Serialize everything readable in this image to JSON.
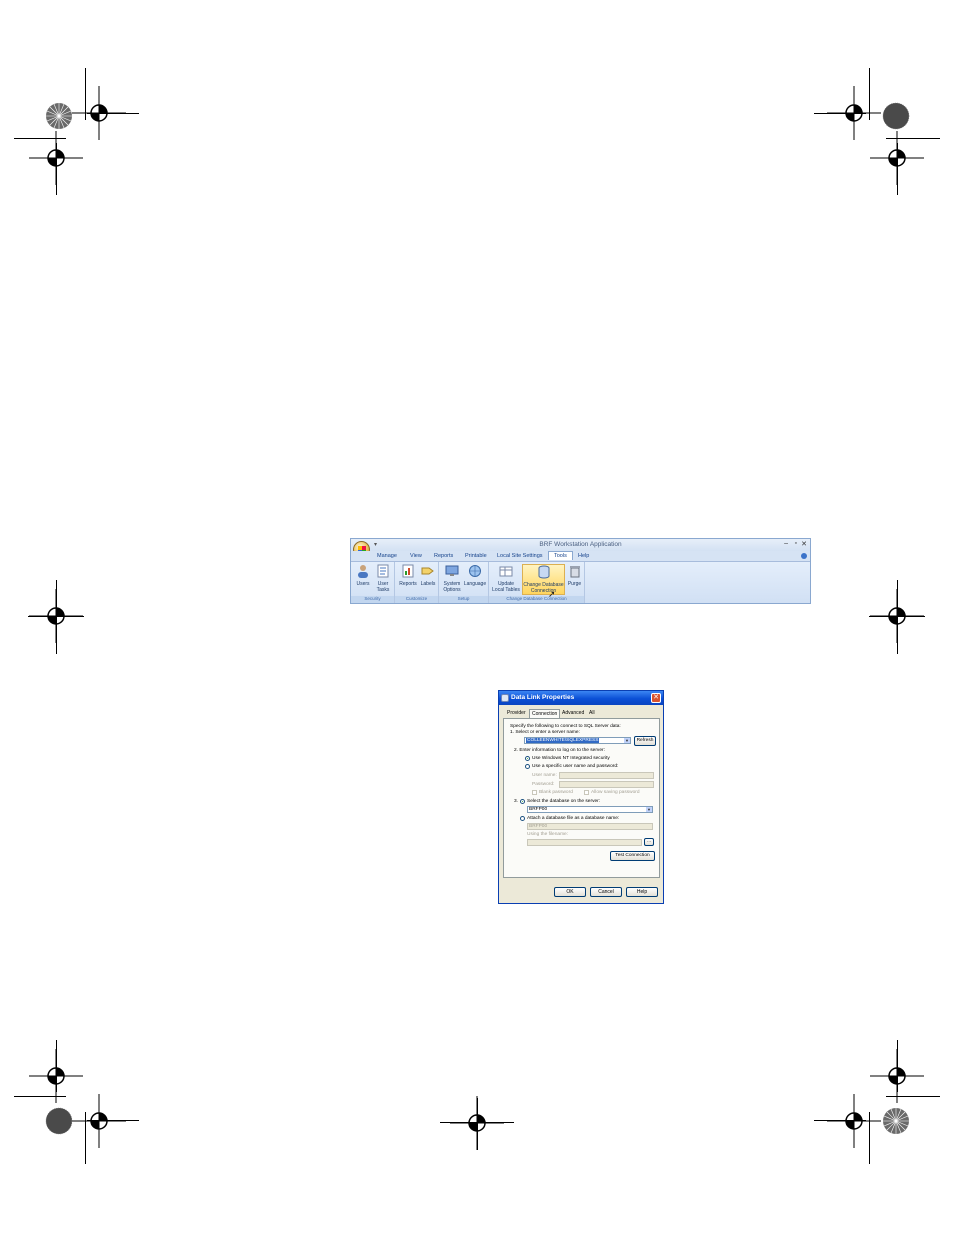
{
  "ribbon": {
    "title": "BRF Workstation Application",
    "qat": "▾",
    "controls": [
      "–",
      "▫",
      "✕"
    ],
    "tabs": [
      "Manage",
      "View",
      "Reports",
      "Printable",
      "Local Site Settings",
      "Tools",
      "Help"
    ],
    "active_tab": "Tools",
    "groups": [
      {
        "label": "Security",
        "commands": [
          "Users",
          "User\nTasks"
        ]
      },
      {
        "label": "Customize",
        "commands": [
          "Reports",
          "Labels"
        ]
      },
      {
        "label": "Setup",
        "commands": [
          "System\nOptions",
          "Language"
        ]
      },
      {
        "label": "Change Database Connection",
        "commands": [
          "Update\nLocal Tables",
          "Change Database\nConnection",
          "Purge"
        ]
      }
    ]
  },
  "dialog": {
    "title": "Data Link Properties",
    "close": "✕",
    "tabs": [
      "Provider",
      "Connection",
      "Advanced",
      "All"
    ],
    "active_tab": "Connection",
    "intro": "Specify the following to connect to SQL Server data:",
    "step1": "1. Select or enter a server name:",
    "server_value": "COLLEENWHITE\\SQLEXPRESS",
    "refresh": "Refresh",
    "step2": "2. Enter information to log on to the server:",
    "opt_nt": "Use Windows NT Integrated security",
    "opt_specific": "Use a specific user name and password:",
    "user_name": "User name:",
    "password": "Password:",
    "blank_pw": "Blank password",
    "allow_save": "Allow saving password",
    "step3": "3.",
    "opt_select_db": "Select the database on the server:",
    "db_value": "BRFP00",
    "opt_attach": "Attach a database file as a database name:",
    "attach_value": "BRFP00",
    "using_filename": "Using the filename:",
    "browse": "...",
    "test": "Test Connection",
    "ok": "OK",
    "cancel": "Cancel",
    "help": "Help"
  }
}
